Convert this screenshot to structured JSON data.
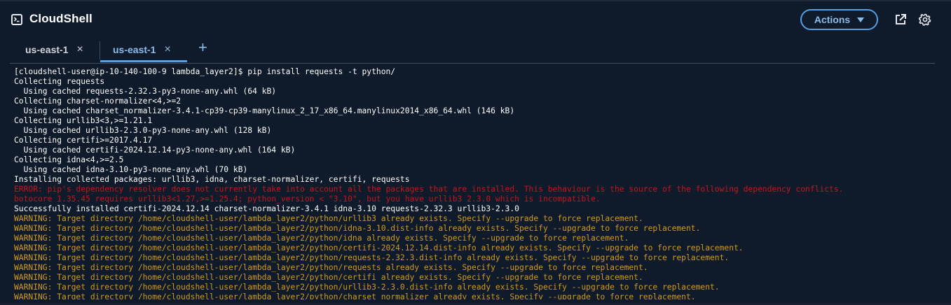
{
  "app": {
    "title": "CloudShell",
    "actions_label": "Actions",
    "icons": {
      "logo": "terminal-icon",
      "open_new": "external-link-icon",
      "settings": "gear-icon",
      "actions_caret": "caret-down-icon"
    }
  },
  "tabs": [
    {
      "label": "us-east-1",
      "close": "×",
      "active": false
    },
    {
      "label": "us-east-1",
      "close": "×",
      "active": true
    }
  ],
  "add_tab_label": "+",
  "colors": {
    "background": "#0f1b2a",
    "accent": "#539fe5",
    "accent_text": "#89bdee",
    "error": "#c4161c",
    "warning": "#d29a1c",
    "text": "#ffffff"
  },
  "terminal": {
    "lines": [
      {
        "type": "normal",
        "text": "[cloudshell-user@ip-10-140-100-9 lambda_layer2]$ pip install requests -t python/"
      },
      {
        "type": "normal",
        "text": "Collecting requests"
      },
      {
        "type": "normal",
        "text": "  Using cached requests-2.32.3-py3-none-any.whl (64 kB)"
      },
      {
        "type": "normal",
        "text": "Collecting charset-normalizer<4,>=2"
      },
      {
        "type": "normal",
        "text": "  Using cached charset_normalizer-3.4.1-cp39-cp39-manylinux_2_17_x86_64.manylinux2014_x86_64.whl (146 kB)"
      },
      {
        "type": "normal",
        "text": "Collecting urllib3<3,>=1.21.1"
      },
      {
        "type": "normal",
        "text": "  Using cached urllib3-2.3.0-py3-none-any.whl (128 kB)"
      },
      {
        "type": "normal",
        "text": "Collecting certifi>=2017.4.17"
      },
      {
        "type": "normal",
        "text": "  Using cached certifi-2024.12.14-py3-none-any.whl (164 kB)"
      },
      {
        "type": "normal",
        "text": "Collecting idna<4,>=2.5"
      },
      {
        "type": "normal",
        "text": "  Using cached idna-3.10-py3-none-any.whl (70 kB)"
      },
      {
        "type": "normal",
        "text": "Installing collected packages: urllib3, idna, charset-normalizer, certifi, requests"
      },
      {
        "type": "error",
        "text": "ERROR: pip's dependency resolver does not currently take into account all the packages that are installed. This behaviour is the source of the following dependency conflicts."
      },
      {
        "type": "error",
        "text": "botocore 1.35.45 requires urllib3<1.27,>=1.25.4; python_version < \"3.10\", but you have urllib3 2.3.0 which is incompatible."
      },
      {
        "type": "normal",
        "text": "Successfully installed certifi-2024.12.14 charset-normalizer-3.4.1 idna-3.10 requests-2.32.3 urllib3-2.3.0"
      },
      {
        "type": "warning",
        "text": "WARNING: Target directory /home/cloudshell-user/lambda_layer2/python/urllib3 already exists. Specify --upgrade to force replacement."
      },
      {
        "type": "warning",
        "text": "WARNING: Target directory /home/cloudshell-user/lambda_layer2/python/idna-3.10.dist-info already exists. Specify --upgrade to force replacement."
      },
      {
        "type": "warning",
        "text": "WARNING: Target directory /home/cloudshell-user/lambda_layer2/python/idna already exists. Specify --upgrade to force replacement."
      },
      {
        "type": "warning",
        "text": "WARNING: Target directory /home/cloudshell-user/lambda_layer2/python/certifi-2024.12.14.dist-info already exists. Specify --upgrade to force replacement."
      },
      {
        "type": "warning",
        "text": "WARNING: Target directory /home/cloudshell-user/lambda_layer2/python/requests-2.32.3.dist-info already exists. Specify --upgrade to force replacement."
      },
      {
        "type": "warning",
        "text": "WARNING: Target directory /home/cloudshell-user/lambda_layer2/python/requests already exists. Specify --upgrade to force replacement."
      },
      {
        "type": "warning",
        "text": "WARNING: Target directory /home/cloudshell-user/lambda_layer2/python/certifi already exists. Specify --upgrade to force replacement."
      },
      {
        "type": "warning",
        "text": "WARNING: Target directory /home/cloudshell-user/lambda_layer2/python/urllib3-2.3.0.dist-info already exists. Specify --upgrade to force replacement."
      },
      {
        "type": "warning",
        "text": "WARNING: Target directory /home/cloudshell-user/lambda_layer2/python/charset_normalizer already exists. Specify --upgrade to force replacement."
      }
    ]
  }
}
